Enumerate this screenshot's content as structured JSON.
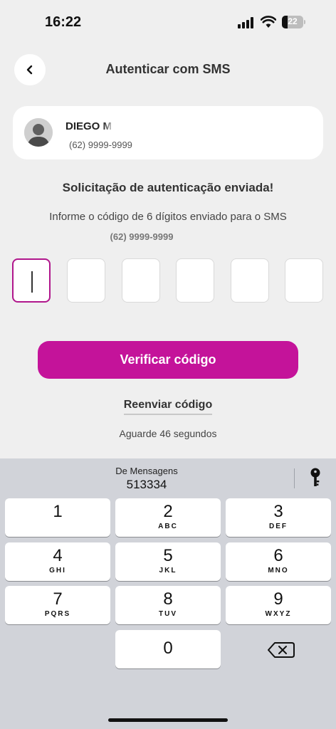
{
  "status_bar": {
    "time": "16:22",
    "battery": "22"
  },
  "header": {
    "title": "Autenticar com SMS"
  },
  "account": {
    "name": "DIEGO M",
    "phone": "(62) 9999-9999"
  },
  "heading": "Solicitação de autenticação enviada!",
  "info_text": "Informe o código de 6 dígitos enviado para o SMS",
  "info_phone": "(62) 9999-9999",
  "code_length": 6,
  "verify_button": "Verificar código",
  "resend_link": "Reenviar código",
  "wait_text": "Aguarde 46 segundos",
  "keyboard": {
    "suggestion_source": "De Mensagens",
    "suggestion_code": "513334",
    "keys": [
      {
        "digit": "1",
        "letters": ""
      },
      {
        "digit": "2",
        "letters": "ABC"
      },
      {
        "digit": "3",
        "letters": "DEF"
      },
      {
        "digit": "4",
        "letters": "GHI"
      },
      {
        "digit": "5",
        "letters": "JKL"
      },
      {
        "digit": "6",
        "letters": "MNO"
      },
      {
        "digit": "7",
        "letters": "PQRS"
      },
      {
        "digit": "8",
        "letters": "TUV"
      },
      {
        "digit": "9",
        "letters": "WXYZ"
      },
      {
        "digit": "0",
        "letters": ""
      }
    ],
    "icons": {
      "passwords": "key-icon",
      "delete": "delete-backspace-icon"
    }
  },
  "colors": {
    "accent": "#c4139a",
    "background": "#efefef",
    "keyboard_bg": "#d1d3d9"
  }
}
